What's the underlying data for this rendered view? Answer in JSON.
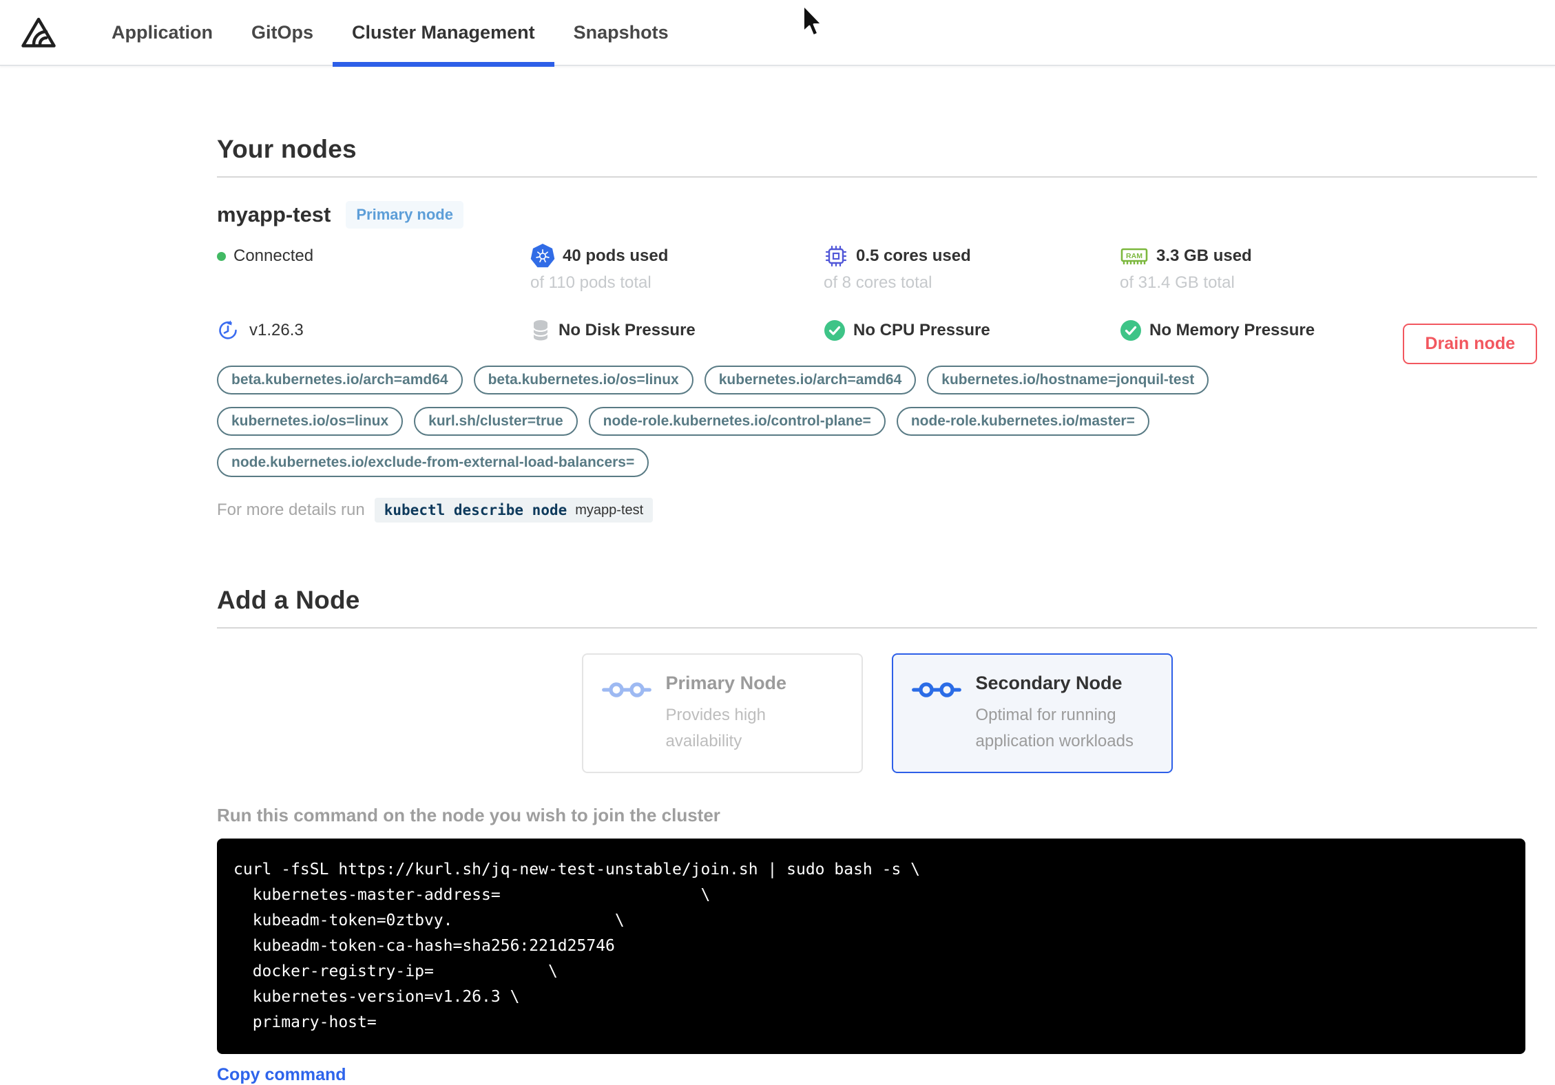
{
  "nav": {
    "tabs": [
      {
        "label": "Application",
        "active": false
      },
      {
        "label": "GitOps",
        "active": false
      },
      {
        "label": "Cluster Management",
        "active": true
      },
      {
        "label": "Snapshots",
        "active": false
      }
    ]
  },
  "your_nodes": {
    "title": "Your nodes",
    "node": {
      "name": "myapp-test",
      "badge": "Primary node",
      "status": "Connected",
      "version": "v1.26.3",
      "stats": [
        {
          "icon": "kubernetes-pods-icon",
          "used": "40 pods used",
          "total": "of 110 pods total"
        },
        {
          "icon": "cpu-chip-icon",
          "used": "0.5 cores used",
          "total": "of 8 cores total"
        },
        {
          "icon": "ram-icon",
          "used": "3.3 GB used",
          "total": "of 31.4 GB total"
        }
      ],
      "pressures": [
        {
          "icon": "disk-icon",
          "label": "No Disk Pressure"
        },
        {
          "icon": "check-circle-icon",
          "label": "No CPU Pressure"
        },
        {
          "icon": "check-circle-icon",
          "label": "No Memory Pressure"
        }
      ],
      "labels": [
        "beta.kubernetes.io/arch=amd64",
        "beta.kubernetes.io/os=linux",
        "kubernetes.io/arch=amd64",
        "kubernetes.io/hostname=jonquil-test",
        "kubernetes.io/os=linux",
        "kurl.sh/cluster=true",
        "node-role.kubernetes.io/control-plane=",
        "node-role.kubernetes.io/master=",
        "node.kubernetes.io/exclude-from-external-load-balancers="
      ],
      "details_prefix": "For more details run",
      "details_cmd": "kubectl describe node",
      "details_node": "myapp-test",
      "drain_label": "Drain node"
    }
  },
  "add_node": {
    "title": "Add a Node",
    "options": [
      {
        "title": "Primary Node",
        "subtitle": "Provides high availability",
        "selected": false
      },
      {
        "title": "Secondary Node",
        "subtitle": "Optimal for running application workloads",
        "selected": true
      }
    ],
    "run_hint": "Run this command on the node you wish to join the cluster",
    "command_lines": [
      "curl -fsSL https://kurl.sh/jq-new-test-unstable/join.sh | sudo bash -s \\",
      "  kubernetes-master-address=                     \\",
      "  kubeadm-token=0ztbvy.                 \\",
      "  kubeadm-token-ca-hash=sha256:221d25746",
      "  docker-registry-ip=            \\",
      "  kubernetes-version=v1.26.3 \\",
      "  primary-host="
    ],
    "copy_label": "Copy command"
  },
  "colors": {
    "accent_blue": "#2d5fe8",
    "tag_teal": "#587a84",
    "danger_red": "#f2575f",
    "success_green": "#3ec487",
    "kubernetes_blue": "#316ce6",
    "ram_green": "#7cb83e",
    "cpu_indigo": "#5157d8",
    "connected_green": "#41b963"
  }
}
